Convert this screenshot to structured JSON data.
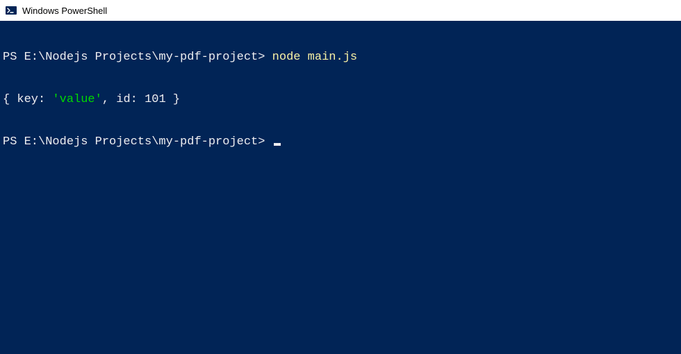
{
  "window": {
    "title": "Windows PowerShell"
  },
  "terminal": {
    "line1_prompt": "PS E:\\Nodejs Projects\\my-pdf-project> ",
    "line1_command": "node main.js",
    "line2_open": "{ key: ",
    "line2_string": "'value'",
    "line2_mid": ", id: ",
    "line2_num": "101",
    "line2_close": " }",
    "line3_prompt": "PS E:\\Nodejs Projects\\my-pdf-project> "
  }
}
